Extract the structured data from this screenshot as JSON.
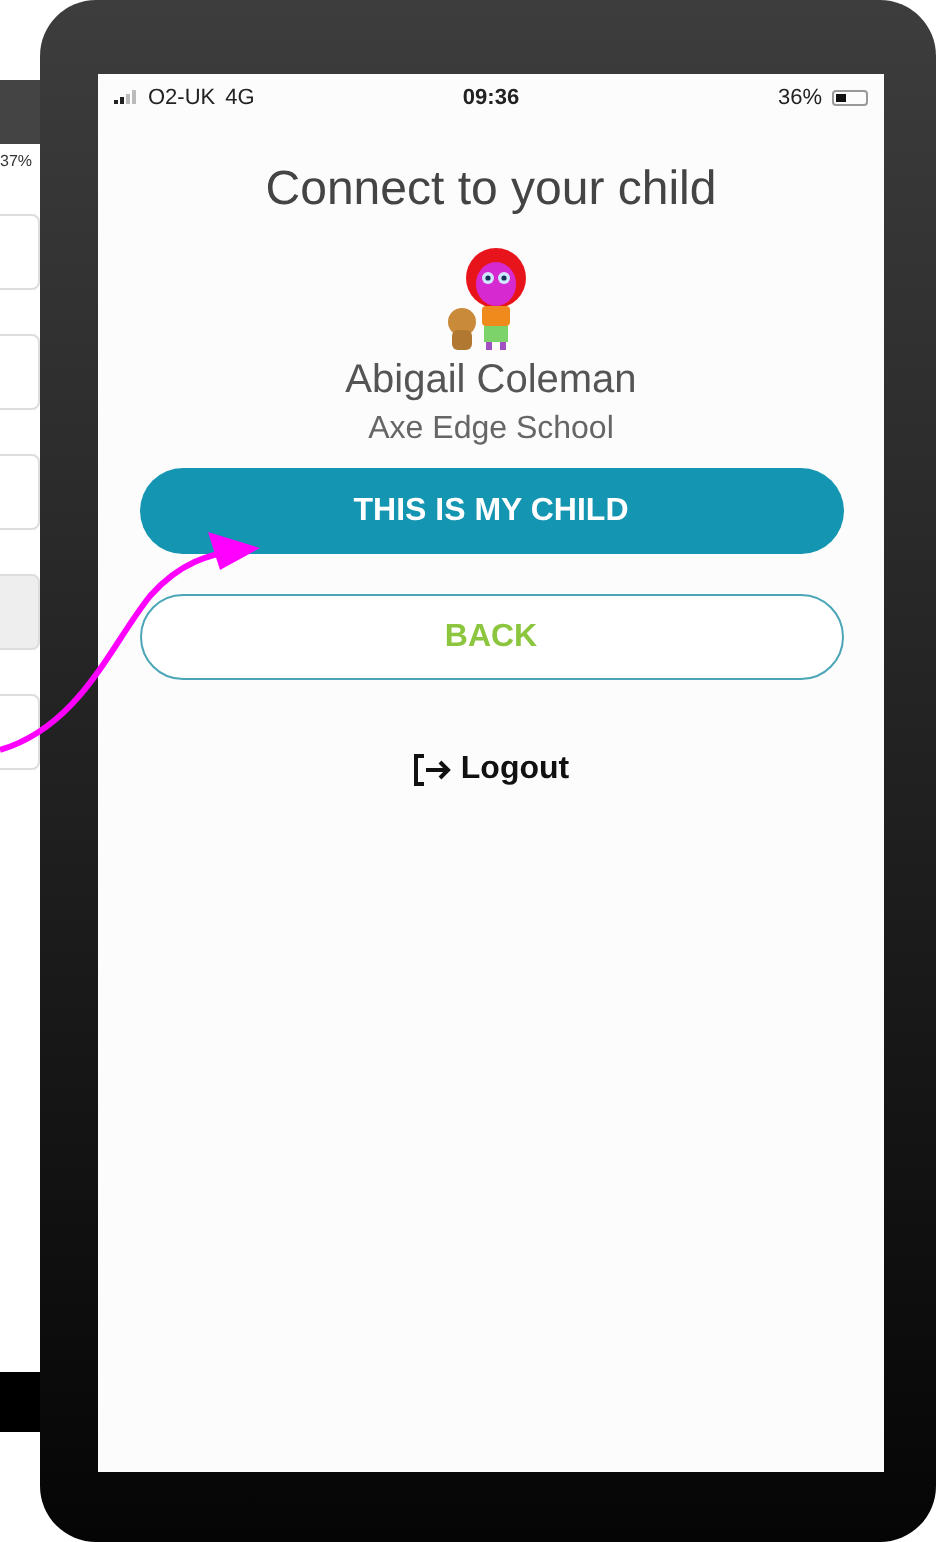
{
  "background_phone": {
    "battery": "37%"
  },
  "status_bar": {
    "carrier": "O2-UK",
    "network": "4G",
    "time": "09:36",
    "battery": "36%"
  },
  "title": "Connect to your child",
  "child": {
    "name": "Abigail Coleman",
    "school": "Axe Edge School"
  },
  "buttons": [
    {
      "label": "THIS IS MY CHILD",
      "kind": "primary"
    },
    {
      "label": "BACK",
      "kind": "outline"
    }
  ],
  "logout": "Logout"
}
